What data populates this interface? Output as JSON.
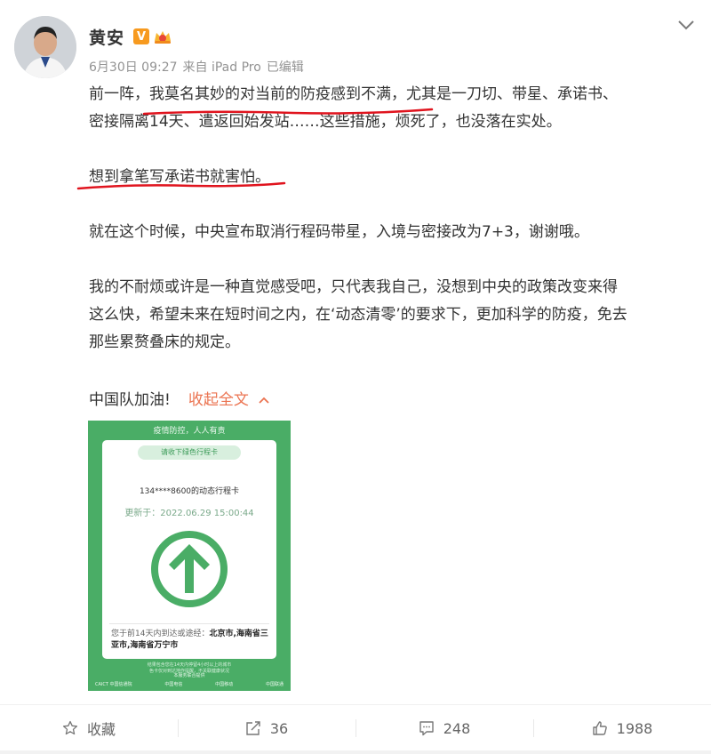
{
  "user": {
    "name": "黄安",
    "verified_badge": "V",
    "member_badge_icon": "vip-crown-icon"
  },
  "meta": {
    "date": "6月30日 09:27",
    "source": "来自 iPad Pro",
    "edited": "已编辑"
  },
  "post": {
    "paragraphs": [
      [
        "前一阵，我莫名其妙的对当前的防疫感到不满，尤其是一刀切、带星、承诺书、",
        "密接隔离14天、遣返回始发站……这些措施，烦死了，也没落在实处。"
      ],
      [
        "想到拿笔写承诺书就害怕。"
      ],
      [
        "就在这个时候，中央宣布取消行程码带星，入境与密接改为7+3，谢谢哦。"
      ],
      [
        "我的不耐烦或许是一种直觉感受吧，只代表我自己，没想到中央的政策改变来得",
        "这么快，希望未来在短时间之内，在‘动态清零’的要求下，更加科学的防疫，免去",
        "那些累赘叠床的规定。"
      ]
    ],
    "closing": "中国队加油!",
    "collapse_label": "收起全文"
  },
  "image": {
    "top_text": "疫情防控，人人有责",
    "chip_text": "请收下绿色行程卡",
    "phone_line": "134****8600的动态行程卡",
    "updated_line": "更新于：2022.06.29 15:00:44",
    "places_prefix": "您于前14天内到达或途经：",
    "places_value": "北京市,海南省三亚市,海南省万宁市",
    "note_line1": "结果包含您在14天内停留4小时以上的城市",
    "note_line2": "色卡仅对到达地作提醒，不关联健康状况",
    "provider": "本服务联合提供",
    "logos": [
      "CAICT 中国信通院",
      "中国电信",
      "中国移动",
      "中国联通"
    ],
    "accent_color": "#4aad66"
  },
  "actions": {
    "favorite": "收藏",
    "share": "36",
    "comment": "248",
    "like": "1988"
  },
  "colors": {
    "link": "#eb7350",
    "annotation_red": "#e0141e",
    "badge_orange": "#f79a1f"
  }
}
